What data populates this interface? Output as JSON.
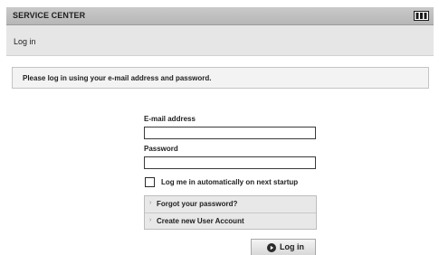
{
  "window": {
    "title": "SERVICE CENTER",
    "logo_icon": "native-instruments-logo-icon"
  },
  "header": {
    "page_title": "Log in"
  },
  "message": {
    "text": "Please log in using your e-mail address and password."
  },
  "form": {
    "email_label": "E-mail address",
    "email_value": "",
    "password_label": "Password",
    "password_value": "",
    "autologin_label": "Log me in automatically on next startup",
    "autologin_checked": false
  },
  "links": [
    {
      "label": "Forgot your password?",
      "icon": "chevron-right-icon"
    },
    {
      "label": "Create new User Account",
      "icon": "chevron-right-icon"
    }
  ],
  "login_button": {
    "label": "Log in",
    "icon": "play-circle-icon"
  },
  "colors": {
    "titlebar": "#bfbfbf",
    "header_band": "#e6e6e6",
    "message_box": "#f3f3f3",
    "panel": "#e8e8e8"
  }
}
